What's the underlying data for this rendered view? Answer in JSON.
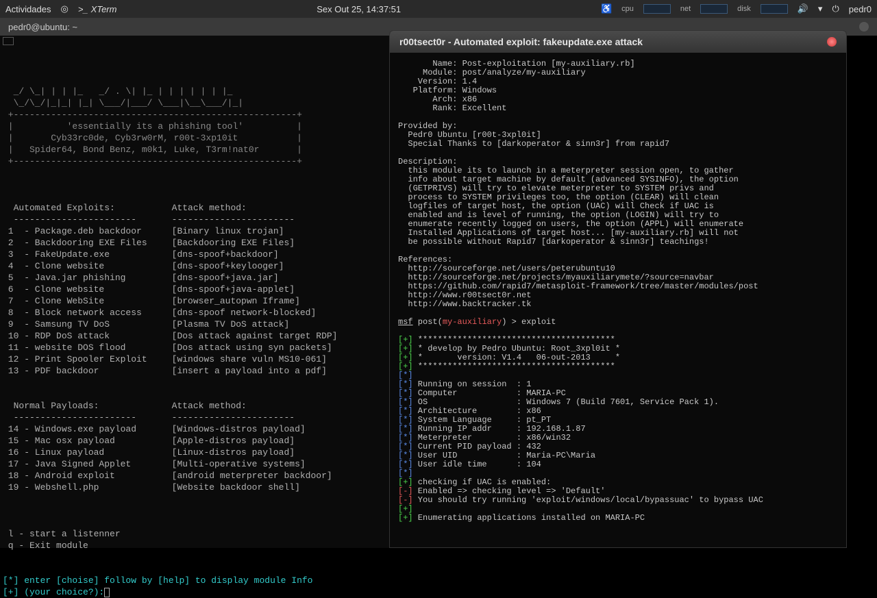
{
  "topbar": {
    "activities": "Actividades",
    "xterm_label": "XTerm",
    "clock": "Sex Out 25, 14:37:51",
    "stats": {
      "cpu": "cpu",
      "net": "net",
      "disk": "disk"
    },
    "user": "pedr0"
  },
  "window_title": "pedr0@ubuntu: ~",
  "banner": {
    "l1": "  _/ \\_| | | |_   _/ . \\| |_ | | | | | | |_ ",
    "l2": "  \\_/\\_/|_|_| |_| \\___/|___/ \\___|\\__\\___/|_|",
    "l3": " +-----------------------------------------------------+",
    "l4": " |          'essentially its a phishing tool'          |",
    "l5": " |       Cyb33rc0de, Cyb3rw0rM, r00t-3xp10it           |",
    "l6": " |   Spider64, Bond Benz, m0k1, Luke, T3rm!nat0r       |",
    "l7": " +-----------------------------------------------------+"
  },
  "headers": {
    "automated": "Automated Exploits:",
    "attack_method": "Attack method:",
    "normal": "Normal Payloads:",
    "dashes": "-----------------------"
  },
  "exploits": [
    {
      "n": "1",
      "name": "Package.deb backdoor",
      "method": "[Binary linux trojan]"
    },
    {
      "n": "2",
      "name": "Backdooring EXE Files",
      "method": "[Backdooring EXE Files]"
    },
    {
      "n": "3",
      "name": "FakeUpdate.exe",
      "method": "[dns-spoof+backdoor]"
    },
    {
      "n": "4",
      "name": "Clone website",
      "method": "[dns-spoof+keylooger]"
    },
    {
      "n": "5",
      "name": "Java.jar phishing",
      "method": "[dns-spoof+java.jar]"
    },
    {
      "n": "6",
      "name": "Clone website",
      "method": "[dns-spoof+java-applet]"
    },
    {
      "n": "7",
      "name": "Clone WebSite",
      "method": "[browser_autopwn Iframe]"
    },
    {
      "n": "8",
      "name": "Block network access",
      "method": "[dns-spoof network-blocked]"
    },
    {
      "n": "9",
      "name": "Samsung TV DoS",
      "method": "[Plasma TV DoS attack]"
    },
    {
      "n": "10",
      "name": "RDP DoS attack",
      "method": "[Dos attack against target RDP]"
    },
    {
      "n": "11",
      "name": "website DOS flood",
      "method": "[Dos attack using syn packets]"
    },
    {
      "n": "12",
      "name": "Print Spooler Exploit",
      "method": "[windows share vuln MS10-061]"
    },
    {
      "n": "13",
      "name": "PDF backdoor",
      "method": "[insert a payload into a pdf]"
    }
  ],
  "payloads": [
    {
      "n": "14",
      "name": "Windows.exe payload",
      "method": "[Windows-distros payload]"
    },
    {
      "n": "15",
      "name": "Mac osx payload",
      "method": "[Apple-distros payload]"
    },
    {
      "n": "16",
      "name": "Linux payload",
      "method": "[Linux-distros payload]"
    },
    {
      "n": "17",
      "name": "Java Signed Applet",
      "method": "[Multi-operative systems]"
    },
    {
      "n": "18",
      "name": "Android exploit",
      "method": "[android meterpreter backdoor]"
    },
    {
      "n": "19",
      "name": "Webshell.php",
      "method": "[Website backdoor shell]"
    }
  ],
  "menu": {
    "listen": " l - start a listenner",
    "quit": " q - Exit module"
  },
  "prompt": {
    "hint_prefix": " enter [choise] follow by [help] to display module Info",
    "label": " (your choice?):"
  },
  "right": {
    "title": "r00tsect0r - Automated exploit: fakeupdate.exe attack",
    "info": {
      "name_label": "     Name:",
      "name": "Post-exploitation [my-auxiliary.rb]",
      "module_label": "   Module:",
      "module": "post/analyze/my-auxiliary",
      "version_label": "  Version:",
      "version": "1.4",
      "platform_label": " Platform:",
      "platform": "Windows",
      "arch_label": "     Arch:",
      "arch": "x86",
      "rank_label": "     Rank:",
      "rank": "Excellent"
    },
    "provided_by_h": "Provided by:",
    "provided_by": [
      "  Pedr0 Ubuntu [r00t-3xpl0it]",
      "  Special Thanks to [darkoperator & sinn3r] from rapid7"
    ],
    "description_h": "Description:",
    "description": [
      "  this module its to launch in a meterpreter session open, to gather",
      "  info about target machine by default (advanced SYSINFO), the option",
      "  (GETPRIVS) will try to elevate meterpreter to SYSTEM privs and",
      "  process to SYSTEM privileges too, the option (CLEAR) will clean",
      "  logfiles of target host, the option (UAC) will Check if UAC is",
      "  enabled and is level of running, the option (LOGIN) will try to",
      "  enumerate recently logged on users, the option (APPL) will enumerate",
      "  Installed Applications of target host... [my-auxiliary.rb] will not",
      "  be possible without Rapid7 [darkoperator & sinn3r] teachings!"
    ],
    "references_h": "References:",
    "references": [
      "  http://sourceforge.net/users/peterubuntu10",
      "  http://sourceforge.net/projects/myauxiliarymete/?source=navbar",
      "  https://github.com/rapid7/metasploit-framework/tree/master/modules/post",
      "  http://www.r00tsect0r.net",
      "  http://www.backtracker.tk"
    ],
    "msf_prompt": {
      "msf": "msf",
      "post": " post(",
      "mod": "my-auxiliary",
      "close": ") > ",
      "cmd": "exploit"
    },
    "stars": "****************************************",
    "dev_line": "* develop by Pedro Ubuntu: Root_3xpl0it *",
    "ver_line": "*       version: V1.4   06-out-2013     *",
    "session_info": [
      {
        "k": "Running on session",
        "v": "1"
      },
      {
        "k": "Computer",
        "v": "MARIA-PC"
      },
      {
        "k": "OS",
        "v": "Windows 7 (Build 7601, Service Pack 1)."
      },
      {
        "k": "Architecture",
        "v": "x86"
      },
      {
        "k": "System Language",
        "v": "pt_PT"
      },
      {
        "k": "Running IP addr",
        "v": "192.168.1.87"
      },
      {
        "k": "Meterpreter",
        "v": "x86/win32"
      },
      {
        "k": "Current PID payload",
        "v": "432"
      },
      {
        "k": "User UID",
        "v": "Maria-PC\\Maria"
      },
      {
        "k": "User idle time",
        "v": "104"
      }
    ],
    "uac_check": "checking if UAC is enabled:",
    "uac_enabled": "Enabled => checking level => 'Default'",
    "uac_hint": "You should try running 'exploit/windows/local/bypassuac' to bypass UAC",
    "enum_apps": "Enumerating applications installed on MARIA-PC"
  }
}
